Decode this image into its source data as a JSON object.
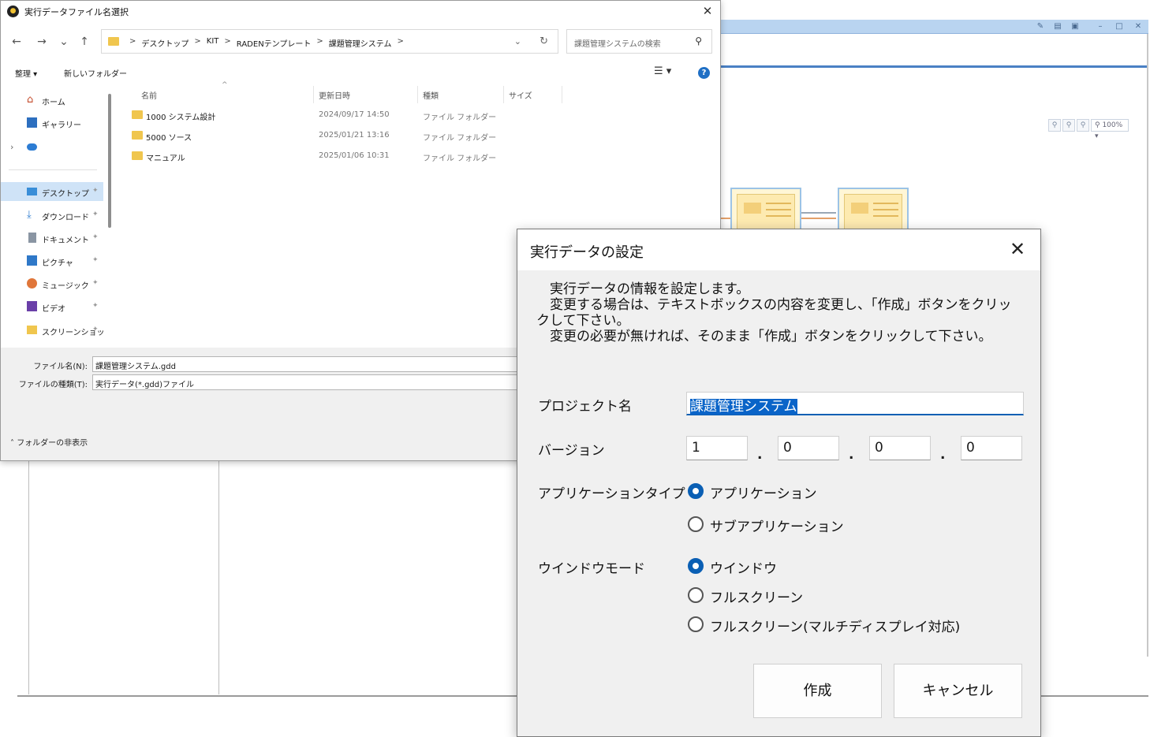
{
  "file_dialog": {
    "title": "実行データファイル名選択",
    "close_glyph": "✕",
    "nav": {
      "back": "←",
      "forward": "→",
      "recent": "⌄",
      "up": "↑"
    },
    "breadcrumb": [
      "デスクトップ",
      "KIT",
      "RADENテンプレート",
      "課題管理システム"
    ],
    "breadcrumb_sep": ">",
    "search_placeholder": "課題管理システムの検索",
    "organize_label": "整理 ▾",
    "new_folder_label": "新しいフォルダー",
    "view_glyph": "☰ ▾",
    "help_glyph": "?",
    "nav_pane": [
      {
        "label": "ホーム",
        "icon": "home-icon"
      },
      {
        "label": "ギャラリー",
        "icon": "gallery-icon"
      },
      {
        "label": "",
        "icon": "cloud-icon"
      },
      {
        "label": "デスクトップ",
        "icon": "desktop-icon",
        "selected": true
      },
      {
        "label": "ダウンロード",
        "icon": "download-icon"
      },
      {
        "label": "ドキュメント",
        "icon": "document-icon"
      },
      {
        "label": "ピクチャ",
        "icon": "picture-icon"
      },
      {
        "label": "ミュージック",
        "icon": "music-icon"
      },
      {
        "label": "ビデオ",
        "icon": "video-icon"
      },
      {
        "label": "スクリーンショッ",
        "icon": "folder-icon"
      }
    ],
    "columns": [
      "名前",
      "更新日時",
      "種類",
      "サイズ"
    ],
    "files": [
      {
        "name": "1000 システム設計",
        "modified": "2024/09/17 14:50",
        "type": "ファイル フォルダー"
      },
      {
        "name": "5000 ソース",
        "modified": "2025/01/21 13:16",
        "type": "ファイル フォルダー"
      },
      {
        "name": "マニュアル",
        "modified": "2025/01/06 10:31",
        "type": "ファイル フォルダー"
      }
    ],
    "filename_label": "ファイル名(N):",
    "filename_value": "課題管理システム.gdd",
    "filetype_label": "ファイルの種類(T):",
    "filetype_value": "実行データ(*.gdd)ファイル",
    "hide_folders_label": "フォルダーの非表示"
  },
  "settings_dialog": {
    "title": "実行データの設定",
    "close_glyph": "✕",
    "info_lines": [
      "　実行データの情報を設定します。",
      "　変更する場合は、テキストボックスの内容を変更し、「作成」ボタンをクリッ",
      "クして下さい。",
      "　変更の必要が無ければ、そのまま「作成」ボタンをクリックして下さい。"
    ],
    "project_label": "プロジェクト名",
    "project_value": "課題管理システム",
    "version_label": "バージョン",
    "version": [
      "1",
      "0",
      "0",
      "0"
    ],
    "version_sep": ".",
    "app_type_label": "アプリケーションタイプ",
    "app_type_options": [
      "アプリケーション",
      "サブアプリケーション"
    ],
    "app_type_selected": 0,
    "window_mode_label": "ウインドウモード",
    "window_mode_options": [
      "ウインドウ",
      "フルスクリーン",
      "フルスクリーン(マルチディスプレイ対応)"
    ],
    "window_mode_selected": 0,
    "create_button": "作成",
    "cancel_button": "キャンセル"
  },
  "background_app": {
    "zoom_label": "100%",
    "accent_color": "#4a80c4"
  }
}
